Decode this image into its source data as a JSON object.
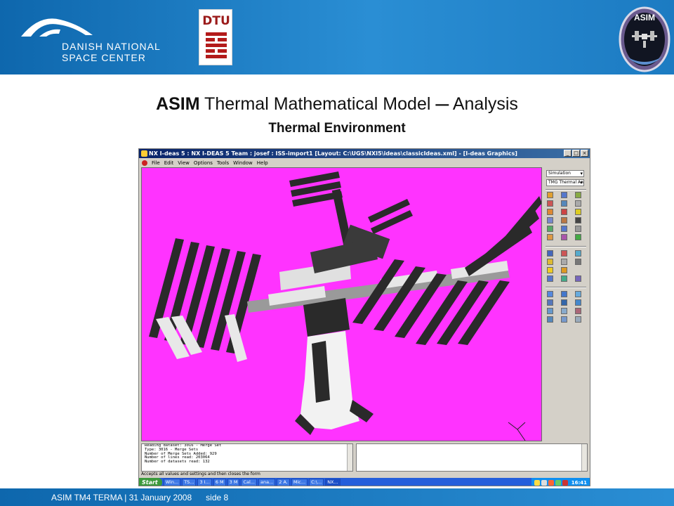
{
  "header": {
    "org_name_line1": "DANISH NATIONAL",
    "org_name_line2": "SPACE CENTER",
    "partner_logo": "DTU",
    "mission_patch": "ASIM",
    "band_color": "#1a7cc8"
  },
  "slide": {
    "title_bold": "ASIM",
    "title_rest": " Thermal Mathematical Model ",
    "title_dash": "–",
    "title_end": " Analysis",
    "subtitle": "Thermal Environment"
  },
  "window": {
    "title": "NX I-deas 5 :   NX I-DEAS 5 Team : josef : ISS-import1  [Layout: C:\\UGS\\NXI5\\ideas\\classicIdeas.xml]  - [I-deas Graphics]",
    "min_label": "_",
    "max_label": "□",
    "close_label": "×",
    "menu": [
      "File",
      "Edit",
      "View",
      "Options",
      "Tools",
      "Window",
      "Help"
    ],
    "viewport_color": "#ff33ff",
    "side_panel": {
      "dropdown1": "Simulation",
      "dropdown2": "TMG Thermal Ana"
    },
    "console_lines": [
      "Reading dataset: 3016 - Merge Set",
      "Type: 3016 - Merge Sets",
      "Number of Merge Sets Added: 929",
      "Number of lines read: 203064",
      "Number of datasets read: 132"
    ],
    "prompt": "Accepts all values and settings and then closes the form"
  },
  "taskbar": {
    "start": "Start",
    "tasks": [
      "Win...",
      "TS...",
      "3 I...",
      "6 M",
      "3 M",
      "Cal...",
      "ana...",
      "2 A.",
      "Mic...",
      "C:\\...",
      "NX..."
    ],
    "clock": "16:41"
  },
  "footer": {
    "text_left": "ASIM TM4  TERMA",
    "separator": "|",
    "date": "31 January 2008",
    "slide_label": "side 8"
  }
}
